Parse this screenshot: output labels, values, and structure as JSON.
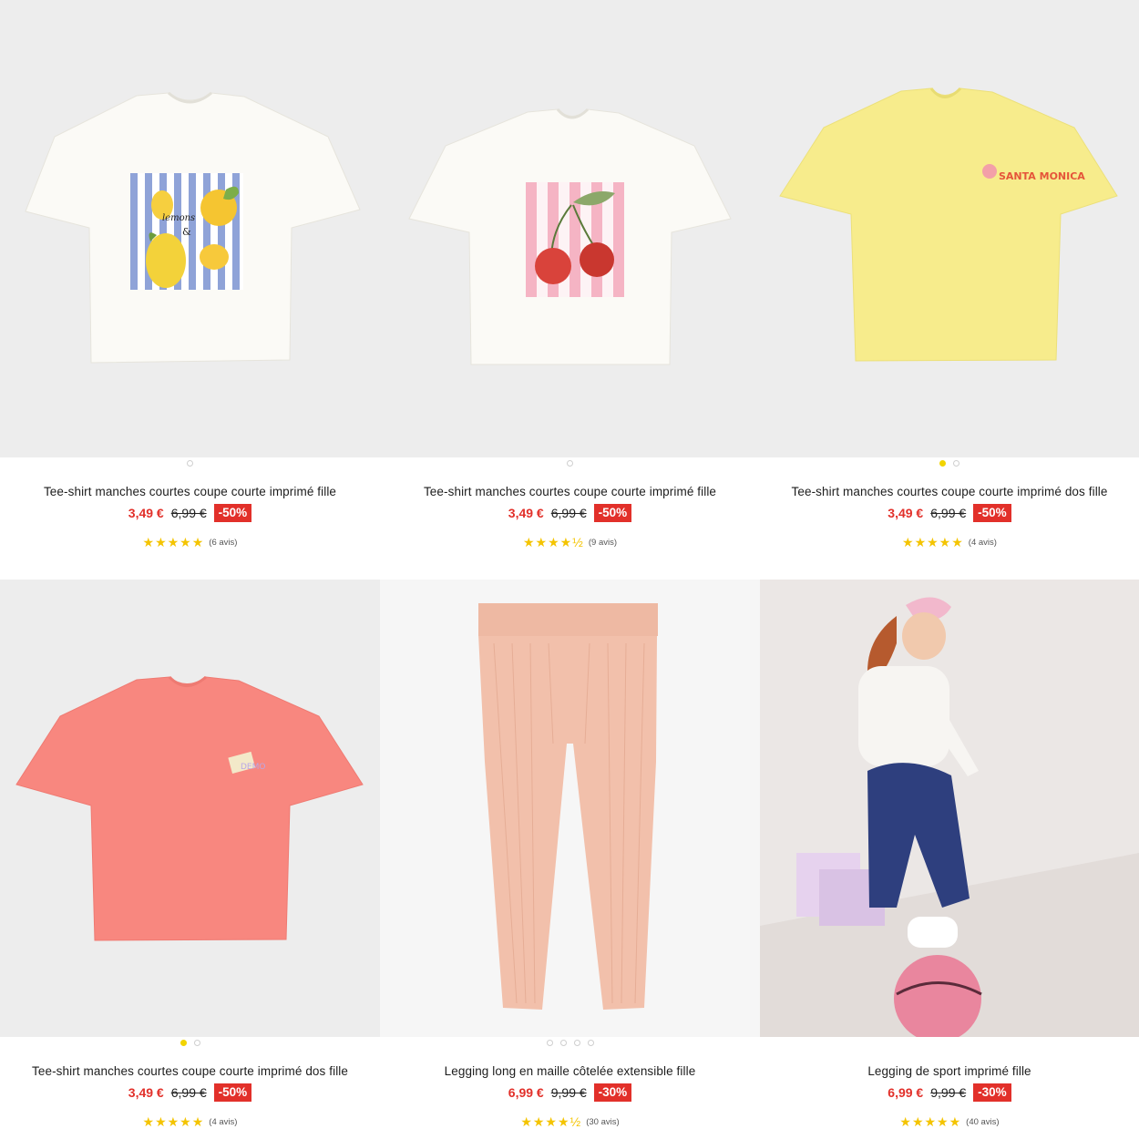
{
  "products": [
    {
      "title": "Tee-shirt manches courtes coupe courte imprimé fille",
      "price": "3,49 €",
      "old_price": "6,99 €",
      "discount": "-50%",
      "stars": "★★★★★",
      "rating_value": 5,
      "reviews": "(6 avis)",
      "image_label": "lemon-print-tee-image",
      "dots": 1,
      "active_dot": 0
    },
    {
      "title": "Tee-shirt manches courtes coupe courte imprimé fille",
      "price": "3,49 €",
      "old_price": "6,99 €",
      "discount": "-50%",
      "stars": "★★★★½",
      "rating_value": 4.5,
      "reviews": "(9 avis)",
      "image_label": "cherry-print-tee-image",
      "dots": 1,
      "active_dot": 0
    },
    {
      "title": "Tee-shirt manches courtes coupe courte imprimé dos fille",
      "price": "3,49 €",
      "old_price": "6,99 €",
      "discount": "-50%",
      "stars": "★★★★★",
      "rating_value": 5,
      "reviews": "(4 avis)",
      "image_label": "yellow-santa-monica-tee-image",
      "print_text": "SANTA MONICA",
      "dots": 2,
      "active_dot": 0
    },
    {
      "title": "Tee-shirt manches courtes coupe courte imprimé dos fille",
      "price": "3,49 €",
      "old_price": "6,99 €",
      "discount": "-50%",
      "stars": "★★★★★",
      "rating_value": 5,
      "reviews": "(4 avis)",
      "image_label": "pink-tee-image",
      "dots": 2,
      "active_dot": 0
    },
    {
      "title": "Legging long en maille côtelée extensible fille",
      "price": "6,99 €",
      "old_price": "9,99 €",
      "discount": "-30%",
      "stars": "★★★★½",
      "rating_value": 4.5,
      "reviews": "(30 avis)",
      "image_label": "ribbed-legging-image",
      "dots": 4,
      "active_dot": -1
    },
    {
      "title": "Legging de sport imprimé fille",
      "price": "6,99 €",
      "old_price": "9,99 €",
      "discount": "-30%",
      "stars": "★★★★★",
      "rating_value": 5,
      "reviews": "(40 avis)",
      "image_label": "sport-legging-model-image",
      "dots": 0,
      "active_dot": -1
    }
  ],
  "colors": {
    "price_red": "#e2302a",
    "star_yellow": "#f4c400",
    "dot_yellow": "#f2d400",
    "image_bg": "#ededed"
  }
}
